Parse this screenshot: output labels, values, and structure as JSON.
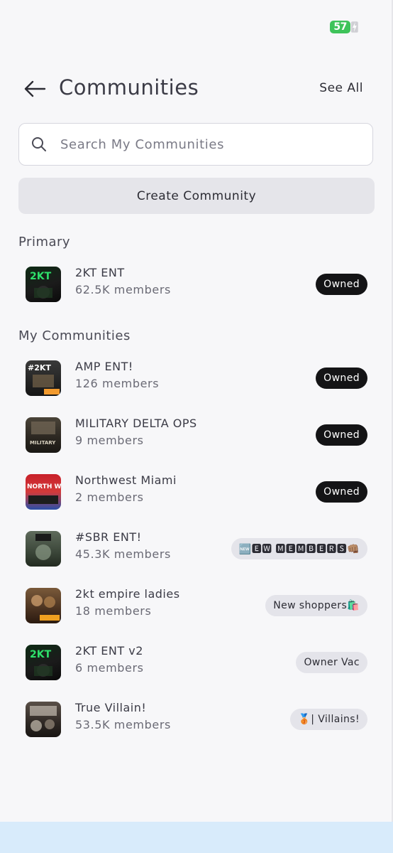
{
  "status_bar": {
    "battery_level": "57",
    "battery_color": "#3ec35a"
  },
  "header": {
    "title": "Communities",
    "see_all_label": "See All"
  },
  "search": {
    "placeholder": "Search My Communities"
  },
  "create_button_label": "Create Community",
  "sections": {
    "primary_title": "Primary",
    "my_communities_title": "My Communities"
  },
  "primary": [
    {
      "name": "2KT ENT",
      "members": "62.5K members",
      "tag": "Owned",
      "tag_style": "dark",
      "thumb_text": "2KT"
    }
  ],
  "communities": [
    {
      "name": "AMP ENT!",
      "members": "126 members",
      "tag": "Owned",
      "tag_style": "dark",
      "thumb_text": "#2KT"
    },
    {
      "name": "MILITARY DELTA OPS",
      "members": "9 members",
      "tag": "Owned",
      "tag_style": "dark",
      "thumb_text": "MILITARY"
    },
    {
      "name": "Northwest Miami",
      "members": "2 members",
      "tag": "Owned",
      "tag_style": "dark",
      "thumb_text": "NORTH WEST"
    },
    {
      "name": "#SBR ENT!",
      "members": "45.3K members",
      "tag": "🆕🅴🆆 🅼🅴🅼🅱🅴🆁🆂👊🏽",
      "tag_style": "light",
      "thumb_text": ""
    },
    {
      "name": "2kt empire ladies",
      "members": "18 members",
      "tag": "New shoppers🛍️",
      "tag_style": "light",
      "thumb_text": ""
    },
    {
      "name": "2KT ENT v2",
      "members": "6 members",
      "tag": "Owner Vac",
      "tag_style": "light",
      "thumb_text": "2KT"
    },
    {
      "name": "True Villain!",
      "members": "53.5K members",
      "tag": "🥉| Villains!",
      "tag_style": "light",
      "thumb_text": ""
    }
  ],
  "colors": {
    "accent_green": "#3ec35a",
    "owned_tag_bg": "#141416",
    "light_tag_bg": "#e4e4ea",
    "bottom_bar": "#d8ebfb"
  }
}
